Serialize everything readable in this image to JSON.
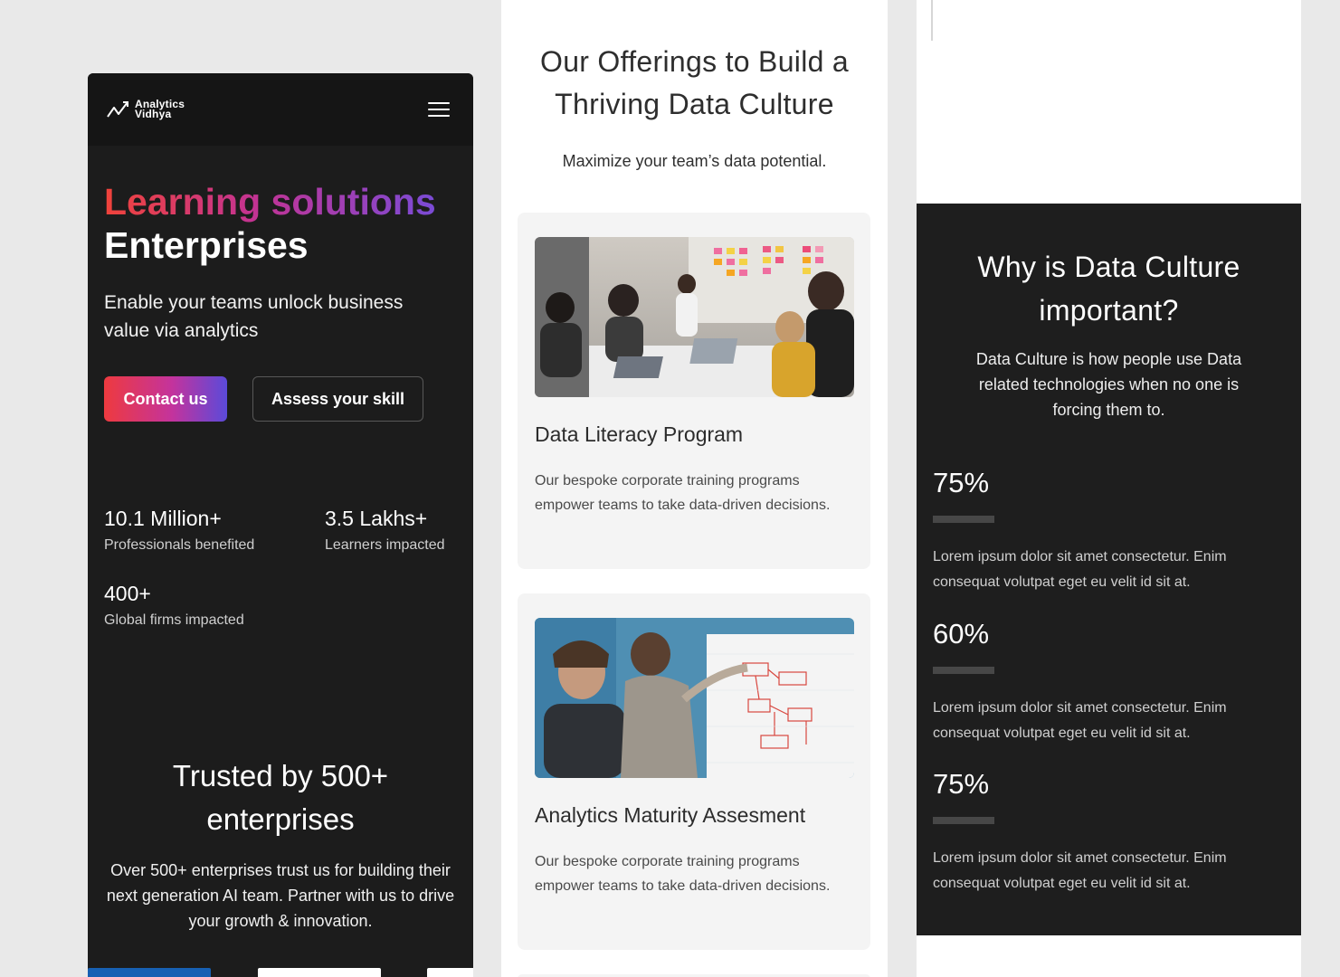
{
  "panel1": {
    "logo": {
      "line1": "Analytics",
      "line2": "Vidhya"
    },
    "hero": {
      "title_gradient": "Learning solutions",
      "title_white": "Enterprises",
      "subtitle": "Enable your teams unlock business value via analytics",
      "contact_button": "Contact us",
      "assess_button": "Assess your skill"
    },
    "stats": [
      {
        "value": "10.1 Million+",
        "label": "Professionals benefited"
      },
      {
        "value": "3.5 Lakhs+",
        "label": "Learners impacted"
      },
      {
        "value": "400+",
        "label": "Global firms impacted"
      }
    ],
    "trusted": {
      "title": "Trusted by 500+ enterprises",
      "text": "Over 500+ enterprises trust us for building their next generation AI team. Partner with us to drive your growth & innovation."
    }
  },
  "panel2": {
    "title": "Our Offerings to Build a Thriving Data Culture",
    "subtitle": "Maximize your team’s data potential.",
    "cards": [
      {
        "title": "Data Literacy Program",
        "description": "Our bespoke corporate training programs empower teams to take data-driven decisions."
      },
      {
        "title": "Analytics Maturity Assesment",
        "description": "Our bespoke corporate training programs empower teams to take data-driven decisions."
      }
    ]
  },
  "panel3": {
    "title": "Why is Data Culture important?",
    "intro": "Data Culture is how people use Data related technologies when  no one is forcing them to.",
    "metrics": [
      {
        "value": "75%",
        "description": "Lorem ipsum dolor sit amet consectetur. Enim consequat volutpat eget eu velit id sit at."
      },
      {
        "value": "60%",
        "description": "Lorem ipsum dolor sit amet consectetur. Enim consequat volutpat eget eu velit id sit at."
      },
      {
        "value": "75%",
        "description": "Lorem ipsum dolor sit amet consectetur. Enim consequat volutpat eget eu velit id sit at."
      }
    ]
  },
  "colors": {
    "dark_bg": "#1c1c1c",
    "gradient_start": "#f0433a",
    "gradient_mid": "#c33392",
    "gradient_end": "#7a4bd6",
    "page_bg": "#e9e9e9"
  }
}
